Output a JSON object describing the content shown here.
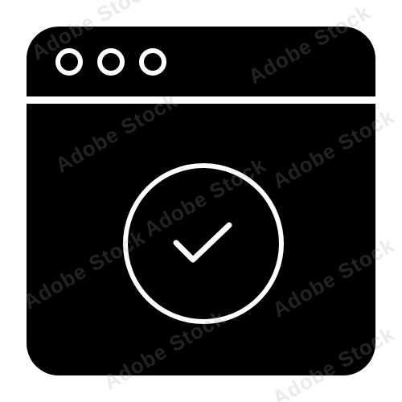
{
  "icon": {
    "name": "browser-window-check-icon",
    "fill_color": "#000000",
    "line_color": "#ffffff",
    "background": "#ffffff"
  },
  "window": {
    "dots": [
      "dot-1",
      "dot-2",
      "dot-3"
    ]
  },
  "watermark": {
    "text": "Adobe Stock",
    "image_id": "#556114731"
  }
}
